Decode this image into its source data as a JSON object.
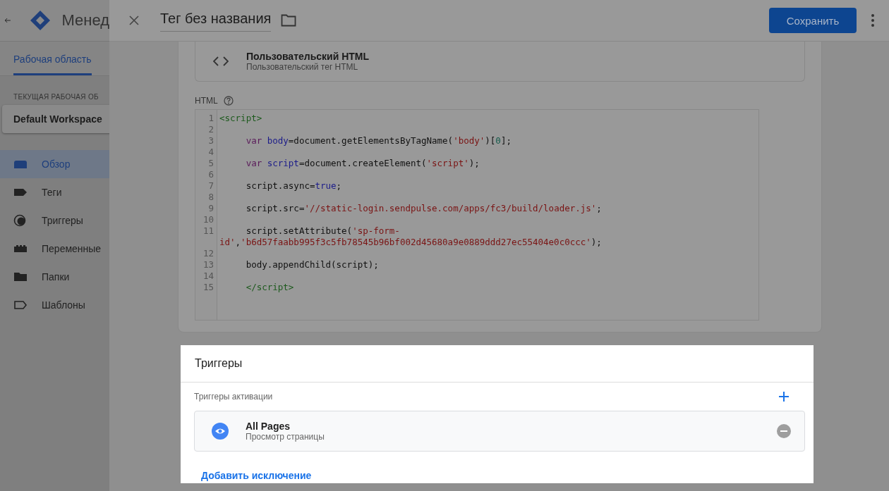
{
  "app": {
    "title": "Менед",
    "tab": "Рабочая область",
    "workspace_label": "ТЕКУЩАЯ РАБОЧАЯ ОБ",
    "workspace": "Default Workspace",
    "nav": [
      {
        "label": "Обзор",
        "kind": "overview",
        "selected": true
      },
      {
        "label": "Теги",
        "kind": "tag",
        "selected": false
      },
      {
        "label": "Триггеры",
        "kind": "trigger",
        "selected": false
      },
      {
        "label": "Переменные",
        "kind": "variable",
        "selected": false
      },
      {
        "label": "Папки",
        "kind": "folder",
        "selected": false
      },
      {
        "label": "Шаблоны",
        "kind": "template",
        "selected": false
      }
    ]
  },
  "panel": {
    "title": "Тег без названия",
    "save": "Сохранить",
    "tag_type": {
      "name": "Пользовательский HTML",
      "description": "Пользовательский тег HTML"
    },
    "html_label": "HTML",
    "code": [
      {
        "number": "1",
        "indented": false,
        "tokens": [
          {
            "text": "<script>",
            "kind": "tag"
          }
        ]
      },
      {
        "number": "2"
      },
      {
        "number": "3",
        "indented": true,
        "tokens": [
          {
            "text": "var",
            "kind": "keyword"
          },
          {
            "text": " body",
            "kind": "def"
          },
          {
            "text": "=document.getElementsByTagName(",
            "kind": "plain"
          },
          {
            "text": "'body'",
            "kind": "string"
          },
          {
            "text": ")[",
            "kind": "plain"
          },
          {
            "text": "0",
            "kind": "number"
          },
          {
            "text": "];",
            "kind": "plain"
          }
        ]
      },
      {
        "number": "4"
      },
      {
        "number": "5",
        "indented": true,
        "tokens": [
          {
            "text": "var",
            "kind": "keyword"
          },
          {
            "text": " script",
            "kind": "def"
          },
          {
            "text": "=document.createElement(",
            "kind": "plain"
          },
          {
            "text": "'script'",
            "kind": "string"
          },
          {
            "text": ");",
            "kind": "plain"
          }
        ]
      },
      {
        "number": "6"
      },
      {
        "number": "7",
        "indented": true,
        "tokens": [
          {
            "text": "script.async=",
            "kind": "plain"
          },
          {
            "text": "true",
            "kind": "atom"
          },
          {
            "text": ";",
            "kind": "plain"
          }
        ]
      },
      {
        "number": "8"
      },
      {
        "number": "9",
        "indented": true,
        "tokens": [
          {
            "text": "script.src=",
            "kind": "plain"
          },
          {
            "text": "'//static-login.sendpulse.com/apps/fc3/build/loader.js'",
            "kind": "string"
          },
          {
            "text": ";",
            "kind": "plain"
          }
        ]
      },
      {
        "number": "10"
      },
      {
        "number": "11",
        "indented": true,
        "tokens": [
          {
            "text": "script.setAttribute(",
            "kind": "plain"
          },
          {
            "text": "'sp-form-id'",
            "kind": "string"
          },
          {
            "text": ",",
            "kind": "plain"
          },
          {
            "text": "'b6d57faabb995f3c5fb78545b96bf002d45680a9e0889ddd27ec55404e0c0ccc'",
            "kind": "string"
          },
          {
            "text": ");",
            "kind": "plain"
          }
        ]
      },
      {
        "number": "12"
      },
      {
        "number": "13",
        "indented": true,
        "tokens": [
          {
            "text": "body.appendChild(script);",
            "kind": "plain"
          }
        ]
      },
      {
        "number": "14"
      },
      {
        "number": "15",
        "indented": true,
        "tokens": [
          {
            "text": "</script>",
            "kind": "tag"
          }
        ]
      }
    ],
    "triggers": {
      "title": "Триггеры",
      "subtitle": "Триггеры активации",
      "items": [
        {
          "name": "All Pages",
          "description": "Просмотр страницы"
        }
      ],
      "add_exception": "Добавить исключение"
    }
  }
}
